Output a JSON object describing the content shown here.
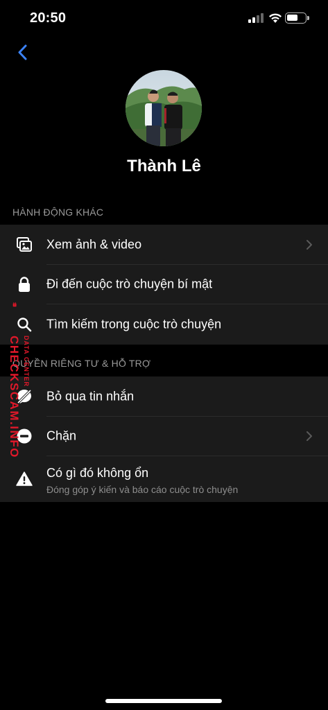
{
  "status_bar": {
    "time": "20:50"
  },
  "profile": {
    "name": "Thành Lê"
  },
  "sections": {
    "other_actions": {
      "title": "HÀNH ĐỘNG KHÁC",
      "items": [
        {
          "label": "Xem ảnh & video",
          "icon": "photos-icon",
          "chevron": true
        },
        {
          "label": "Đi đến cuộc trò chuyện bí mật",
          "icon": "lock-icon",
          "chevron": false
        },
        {
          "label": "Tìm kiếm trong cuộc trò chuyện",
          "icon": "search-icon",
          "chevron": false
        }
      ]
    },
    "privacy_support": {
      "title": "QUYỀN RIÊNG TƯ & HỖ TRỢ",
      "items": [
        {
          "label": "Bỏ qua tin nhắn",
          "icon": "ignore-messages-icon",
          "chevron": false
        },
        {
          "label": "Chặn",
          "icon": "block-icon",
          "chevron": true
        },
        {
          "label": "Có gì đó không ổn",
          "sublabel": "Đóng góp ý kiến và báo cáo cuộc trò chuyện",
          "icon": "warning-icon",
          "chevron": false
        }
      ]
    }
  },
  "watermark": {
    "text": "CHECKSCAM.INFO",
    "subtext": "DATA CENTER"
  },
  "colors": {
    "background": "#000000",
    "group_background": "#1b1b1b",
    "accent": "#3b82f6",
    "watermark": "#e0182a"
  }
}
